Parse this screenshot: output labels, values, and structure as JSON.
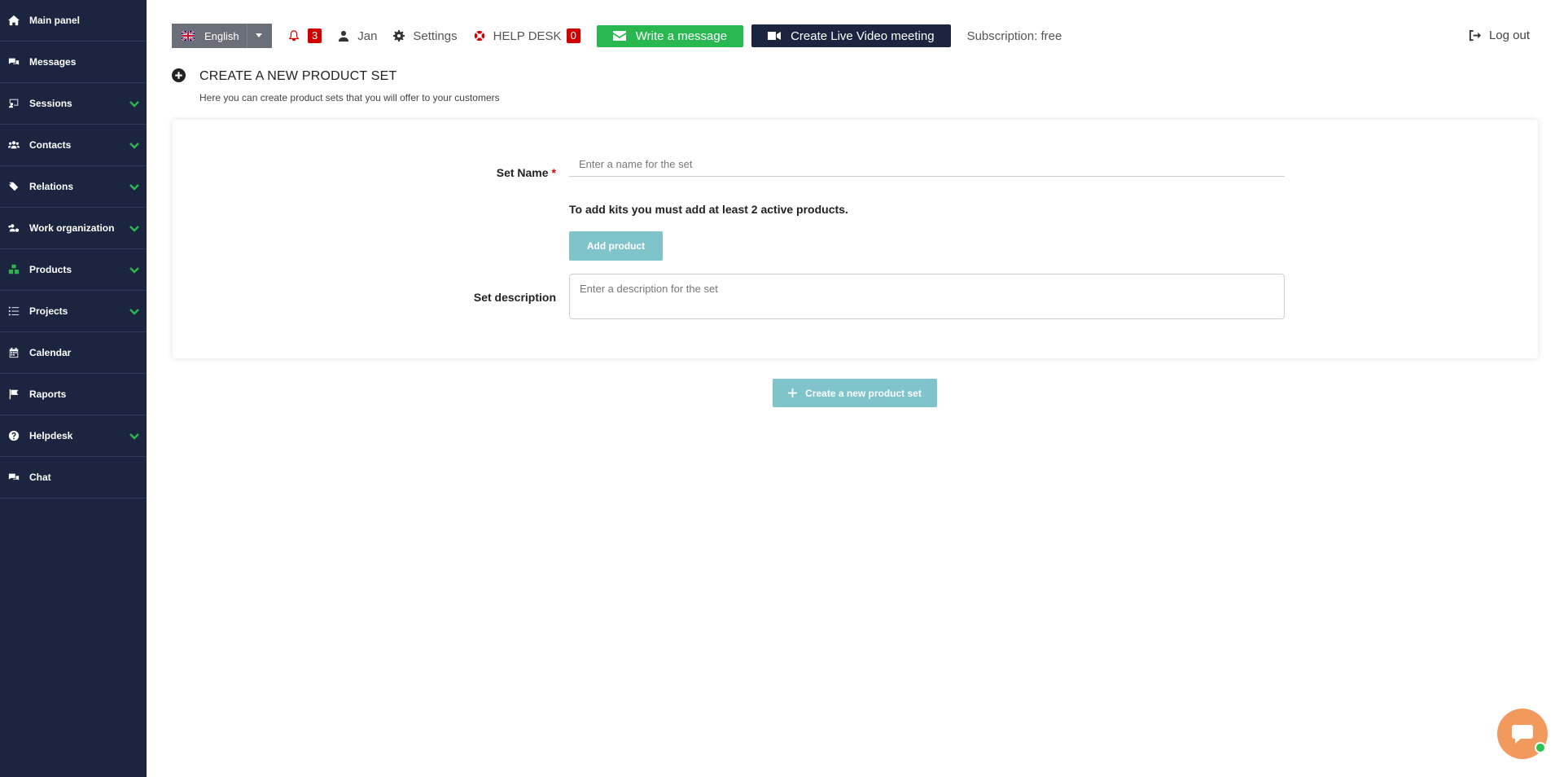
{
  "sidebar": {
    "items": [
      {
        "label": "Main panel",
        "icon": "home-icon",
        "expandable": false
      },
      {
        "label": "Messages",
        "icon": "comments-icon",
        "expandable": false
      },
      {
        "label": "Sessions",
        "icon": "chalkboard-icon",
        "expandable": true
      },
      {
        "label": "Contacts",
        "icon": "users-icon",
        "expandable": true
      },
      {
        "label": "Relations",
        "icon": "tags-icon",
        "expandable": true
      },
      {
        "label": "Work organization",
        "icon": "users-cog-icon",
        "expandable": true
      },
      {
        "label": "Products",
        "icon": "cubes-icon",
        "expandable": true,
        "active": true
      },
      {
        "label": "Projects",
        "icon": "tasks-icon",
        "expandable": true
      },
      {
        "label": "Calendar",
        "icon": "calendar-icon",
        "expandable": false
      },
      {
        "label": "Raports",
        "icon": "flag-icon",
        "expandable": false
      },
      {
        "label": "Helpdesk",
        "icon": "question-circle-icon",
        "expandable": true
      },
      {
        "label": "Chat",
        "icon": "comments-icon",
        "expandable": false
      }
    ]
  },
  "topbar": {
    "language": "English",
    "notifications_count": "3",
    "user_name": "Jan",
    "settings_label": "Settings",
    "helpdesk_label": "HELP DESK",
    "helpdesk_count": "0",
    "write_message_label": "Write a message",
    "video_meeting_label": "Create Live Video meeting",
    "subscription": "Subscription: free",
    "logout_label": "Log out"
  },
  "page": {
    "title": "CREATE A NEW PRODUCT SET",
    "subtitle": "Here you can create product sets that you will offer to your customers"
  },
  "form": {
    "set_name_label": "Set Name",
    "required_mark": "*",
    "set_name_placeholder": "Enter a name for the set",
    "set_name_value": "",
    "info_text": "To add kits you must add at least 2 active products.",
    "add_product_label": "Add product",
    "set_description_label": "Set description",
    "set_description_placeholder": "Enter a description for the set",
    "set_description_value": ""
  },
  "create_button_label": "Create a new product set",
  "colors": {
    "sidebar_bg": "#1b2540",
    "accent_green": "#28b84f",
    "badge_red": "#d30000",
    "disabled_teal": "#7fc3cb",
    "chat_orange": "#f29a5e"
  }
}
